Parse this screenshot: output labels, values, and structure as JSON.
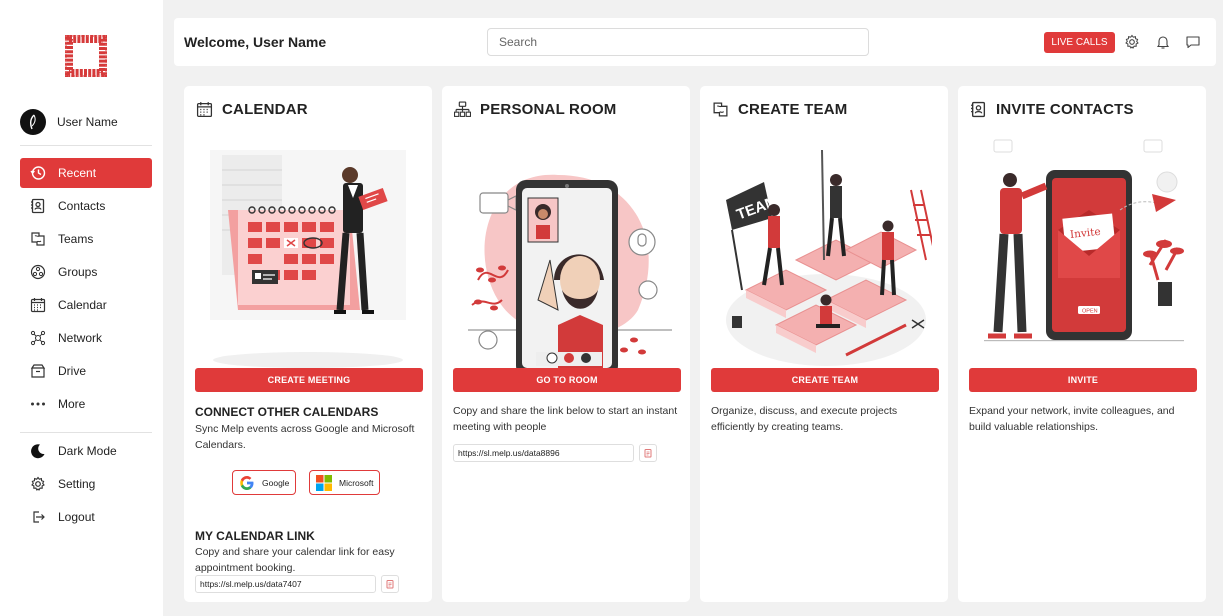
{
  "sidebar": {
    "user_name": "User Name",
    "items": [
      {
        "label": "Recent",
        "icon": "recent-icon",
        "active": true
      },
      {
        "label": "Contacts",
        "icon": "contacts-icon"
      },
      {
        "label": "Teams",
        "icon": "teams-icon"
      },
      {
        "label": "Groups",
        "icon": "groups-icon"
      },
      {
        "label": "Calendar",
        "icon": "calendar-icon"
      },
      {
        "label": "Network",
        "icon": "network-icon"
      },
      {
        "label": "Drive",
        "icon": "drive-icon"
      },
      {
        "label": "More",
        "icon": "more-icon"
      }
    ],
    "bottom_items": [
      {
        "label": "Dark Mode",
        "icon": "moon-icon"
      },
      {
        "label": "Setting",
        "icon": "gear-icon"
      },
      {
        "label": "Logout",
        "icon": "logout-icon"
      }
    ]
  },
  "header": {
    "welcome": "Welcome, User Name",
    "search_placeholder": "Search",
    "live_calls_label": "LIVE CALLS",
    "icons": [
      "gear-icon",
      "bell-icon",
      "chat-icon"
    ]
  },
  "cards": {
    "calendar": {
      "title": "CALENDAR",
      "button": "CREATE MEETING",
      "connect_title": "CONNECT OTHER CALENDARS",
      "connect_desc": "Sync Melp events across Google and Microsoft Calendars.",
      "google_label": "Google",
      "microsoft_label": "Microsoft",
      "link_title": "MY CALENDAR LINK",
      "link_desc": "Copy and share your calendar link for easy appointment booking.",
      "link_value": "https://sl.melp.us/data7407"
    },
    "personal_room": {
      "title": "PERSONAL ROOM",
      "button": "GO TO ROOM",
      "desc": "Copy and share the link below to start an instant meeting with people",
      "link_value": "https://sl.melp.us/data8896"
    },
    "create_team": {
      "title": "CREATE TEAM",
      "button": "CREATE TEAM",
      "desc": "Organize, discuss, and execute projects efficiently by creating teams.",
      "illus_sign": "TEAM"
    },
    "invite_contacts": {
      "title": "INVITE CONTACTS",
      "button": "INVITE",
      "desc": "Expand your network, invite colleagues, and build valuable relationships.",
      "illus_card": "Invite",
      "illus_button": "OPEN"
    }
  },
  "colors": {
    "accent": "#e03a3a",
    "background": "#f1f1f1",
    "card": "#ffffff"
  }
}
